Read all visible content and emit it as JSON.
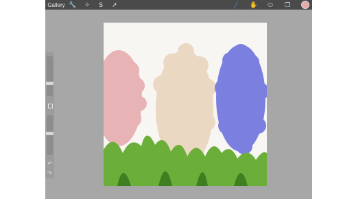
{
  "toolbar": {
    "gallery_label": "Gallery",
    "left_tools": [
      {
        "name": "actions-wrench-icon",
        "glyph": "🔧"
      },
      {
        "name": "adjustments-wand-icon",
        "glyph": "✧"
      },
      {
        "name": "selection-icon",
        "glyph": "S"
      },
      {
        "name": "transform-arrow-icon",
        "glyph": "➚"
      }
    ],
    "right_tools": [
      {
        "name": "brush-icon",
        "glyph": "╱"
      },
      {
        "name": "smudge-icon",
        "glyph": "✋"
      },
      {
        "name": "eraser-icon",
        "glyph": "⬭"
      },
      {
        "name": "layers-icon",
        "glyph": "❐"
      }
    ],
    "active_tool": "brush",
    "active_color": "#e8a9a9"
  },
  "sidebar": {
    "undo_glyph": "↶",
    "redo_glyph": "↷",
    "brush_size_level": 0.3,
    "opacity_level": 0.55
  },
  "canvas": {
    "colors": {
      "pink": "#e8b3b5",
      "cream": "#ead8c2",
      "blue": "#7b7fe0",
      "green": "#6cae3a",
      "dark_green": "#3f7f22",
      "background": "#f7f6f3"
    }
  }
}
